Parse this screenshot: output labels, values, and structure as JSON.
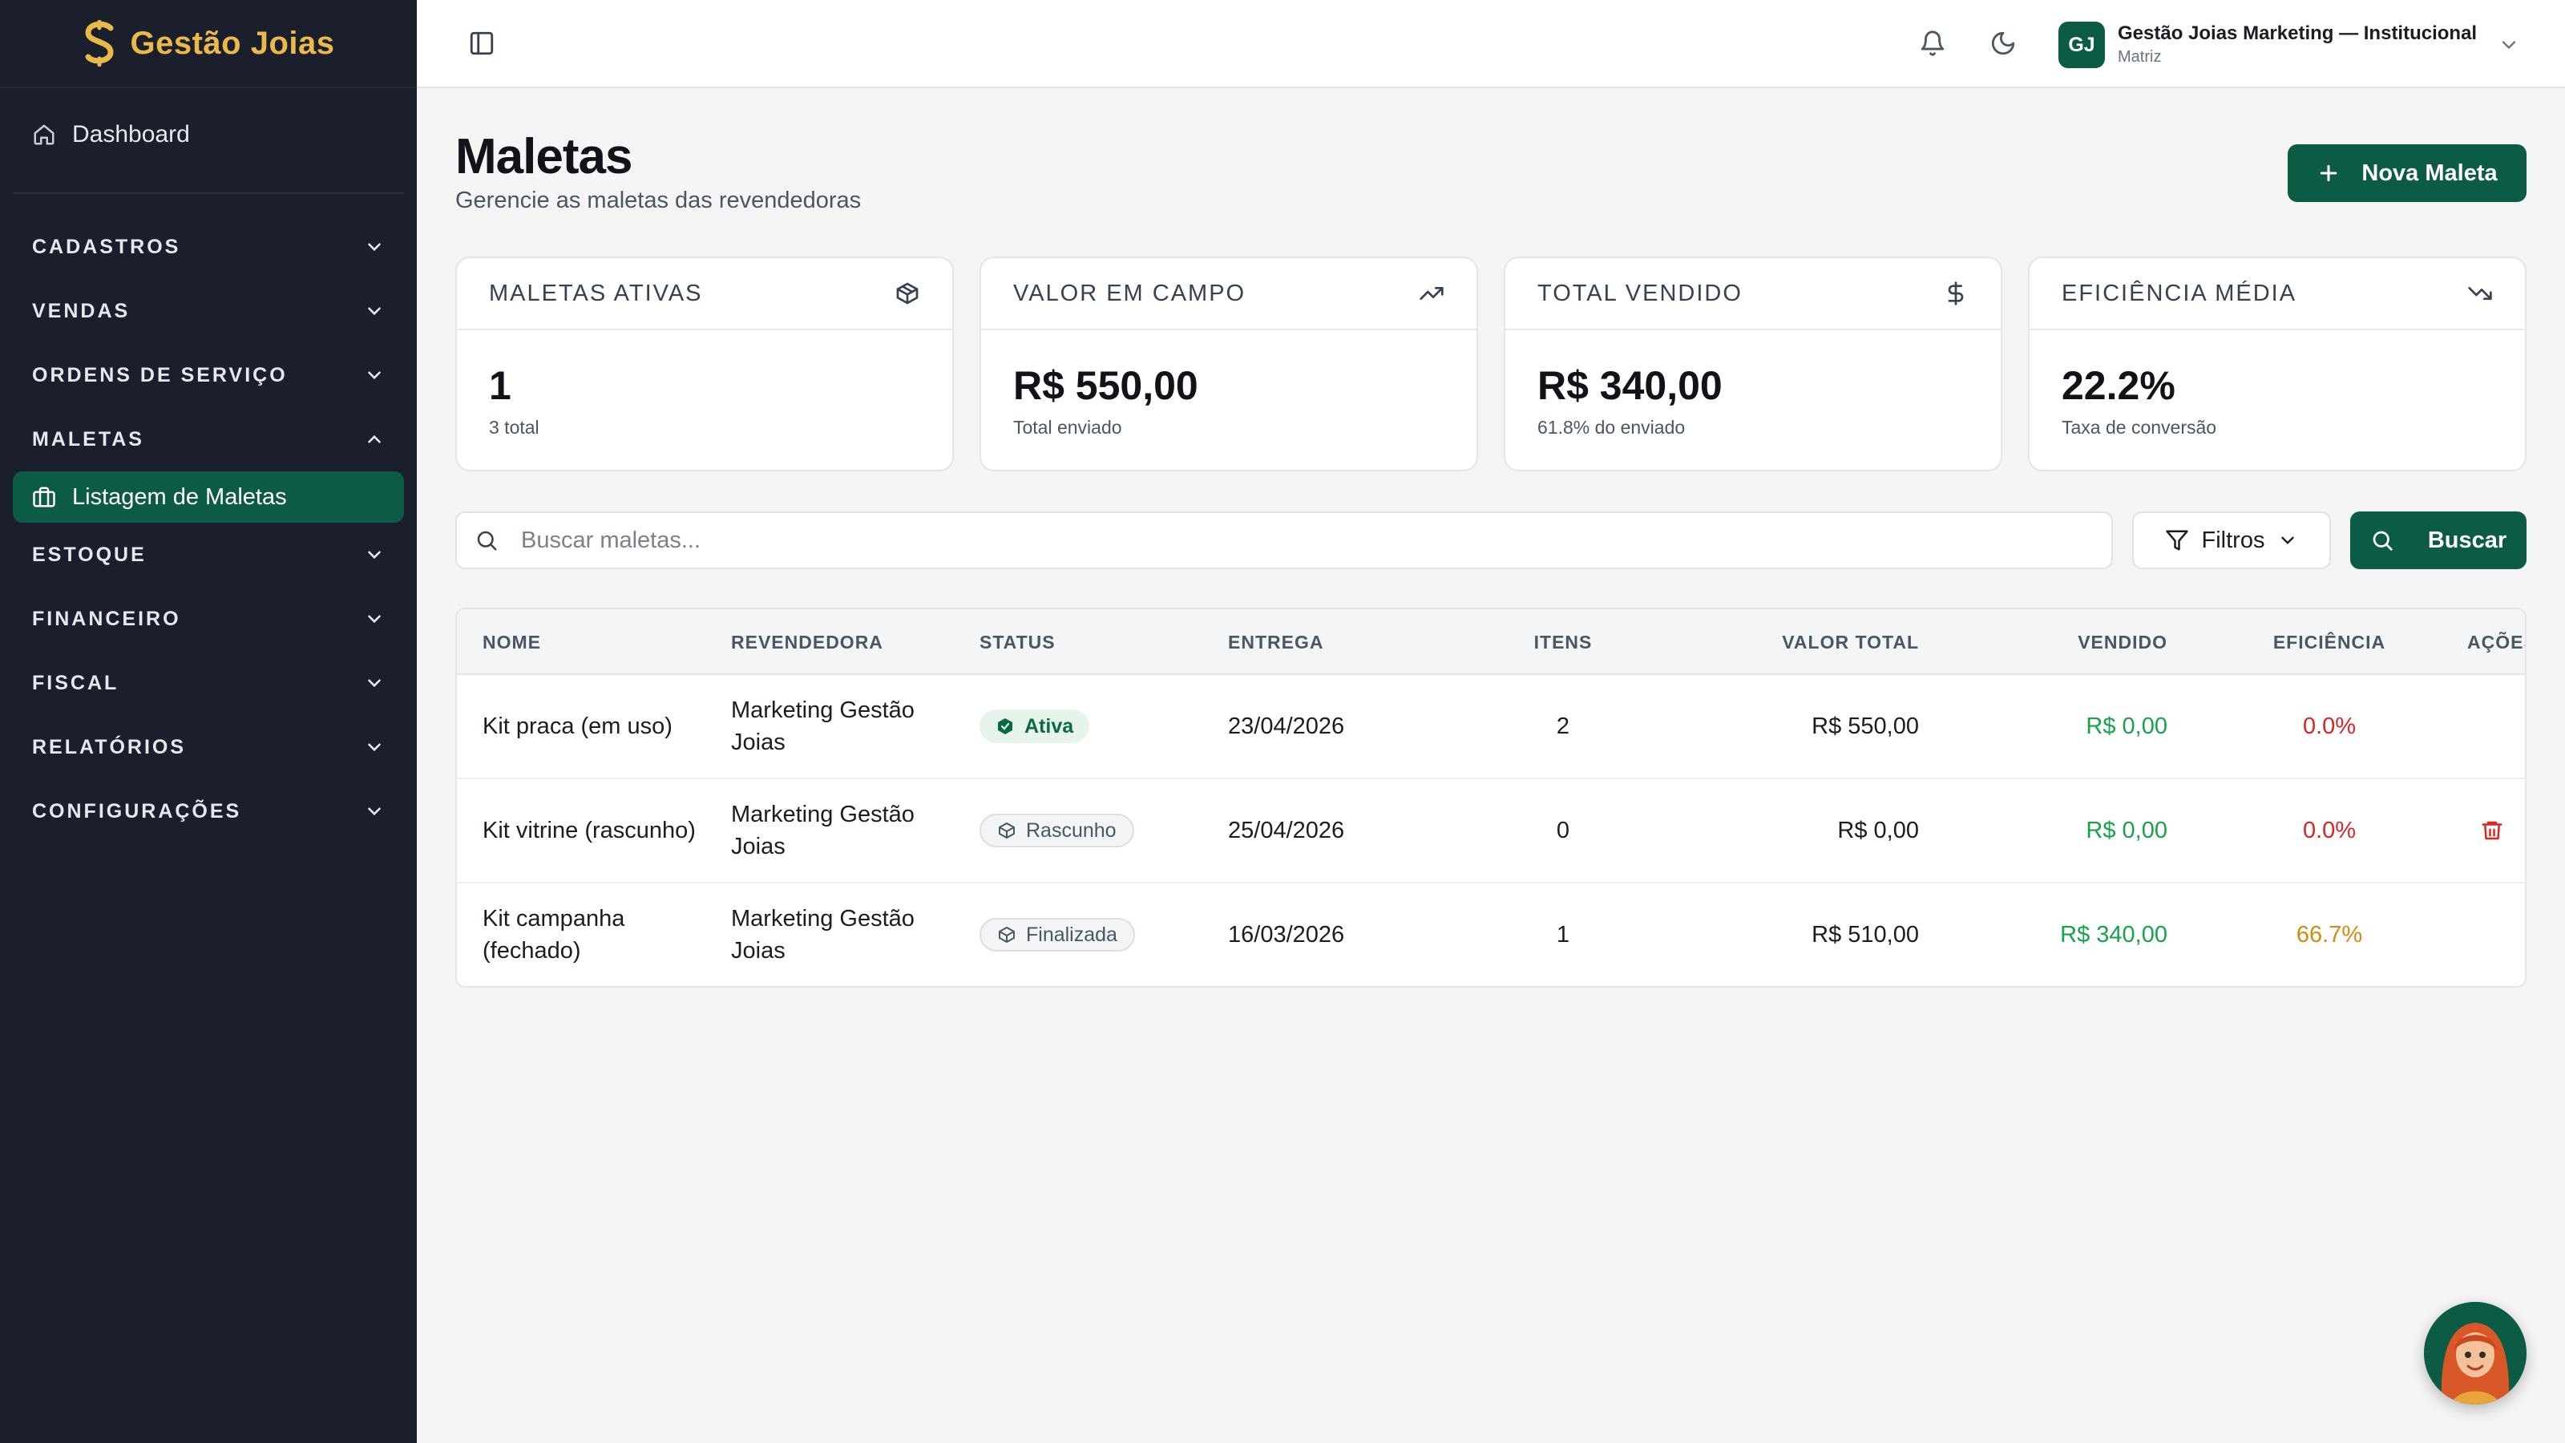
{
  "brand": {
    "name": "Gestão Joias"
  },
  "sidebar": {
    "dashboard_label": "Dashboard",
    "sections": [
      {
        "label": "CADASTROS"
      },
      {
        "label": "VENDAS"
      },
      {
        "label": "ORDENS DE SERVIÇO"
      },
      {
        "label": "MALETAS",
        "expanded": true
      },
      {
        "label": "ESTOQUE"
      },
      {
        "label": "FINANCEIRO"
      },
      {
        "label": "FISCAL"
      },
      {
        "label": "RELATÓRIOS"
      },
      {
        "label": "CONFIGURAÇÕES"
      }
    ],
    "active_item": "Listagem de Maletas"
  },
  "topbar": {
    "avatar_initials": "GJ",
    "user_name": "Gestão Joias Marketing — Institucional",
    "user_sub": "Matriz"
  },
  "page": {
    "title": "Maletas",
    "subtitle": "Gerencie as maletas das revendedoras",
    "new_button": "Nova Maleta"
  },
  "stats": [
    {
      "label": "MALETAS ATIVAS",
      "value": "1",
      "note": "3 total",
      "icon": "package-icon"
    },
    {
      "label": "VALOR EM CAMPO",
      "value": "R$ 550,00",
      "note": "Total enviado",
      "icon": "trending-up-icon"
    },
    {
      "label": "TOTAL VENDIDO",
      "value": "R$ 340,00",
      "note": "61.8% do enviado",
      "icon": "dollar-icon"
    },
    {
      "label": "EFICIÊNCIA MÉDIA",
      "value": "22.2%",
      "note": "Taxa de conversão",
      "icon": "trending-down-icon"
    }
  ],
  "search": {
    "placeholder": "Buscar maletas...",
    "filter_label": "Filtros",
    "search_label": "Buscar"
  },
  "table": {
    "columns": [
      "NOME",
      "REVENDEDORA",
      "STATUS",
      "ENTREGA",
      "ITENS",
      "VALOR TOTAL",
      "VENDIDO",
      "EFICIÊNCIA",
      "AÇÕES"
    ],
    "rows": [
      {
        "nome": "Kit praca (em uso)",
        "revendedora": "Marketing Gestão Joias",
        "status": "Ativa",
        "entrega": "23/04/2026",
        "itens": "2",
        "valor_total": "R$ 550,00",
        "vendido": "R$ 0,00",
        "eficiencia": "0.0%"
      },
      {
        "nome": "Kit vitrine (rascunho)",
        "revendedora": "Marketing Gestão Joias",
        "status": "Rascunho",
        "entrega": "25/04/2026",
        "itens": "0",
        "valor_total": "R$ 0,00",
        "vendido": "R$ 0,00",
        "eficiencia": "0.0%"
      },
      {
        "nome": "Kit campanha (fechado)",
        "revendedora": "Marketing Gestão Joias",
        "status": "Finalizada",
        "entrega": "16/03/2026",
        "itens": "1",
        "valor_total": "R$ 510,00",
        "vendido": "R$ 340,00",
        "eficiencia": "66.7%"
      }
    ]
  },
  "colors": {
    "primary": "#0b5b45",
    "sidebar_bg": "#1b1f2b",
    "brand_gold": "#e9b94a",
    "positive": "#17a34a",
    "negative": "#dc2626",
    "warning": "#d08c12"
  }
}
